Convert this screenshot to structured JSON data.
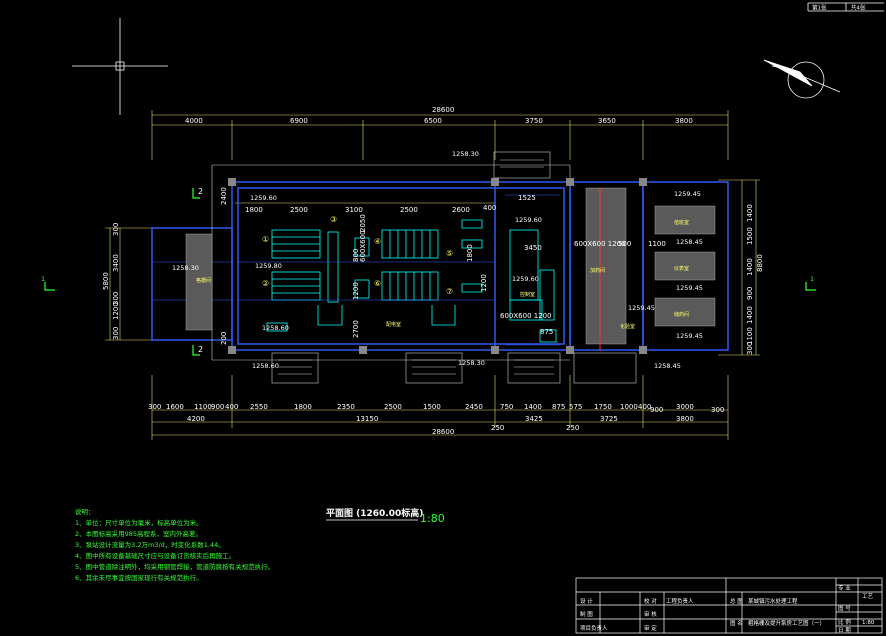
{
  "drawing": {
    "title": "平面图 (1260.00标高)",
    "scale": "1:80"
  },
  "dims_top": {
    "overall": "28600",
    "segments": [
      "4000",
      "6900",
      "6500",
      "3750",
      "3650",
      "3800"
    ]
  },
  "dims_bottom": {
    "overall": "28600",
    "row1": [
      "300",
      "1600",
      "1100",
      "900",
      "400",
      "2550",
      "1800",
      "2350",
      "2500",
      "1500",
      "2450",
      "750",
      "1400",
      "875",
      "575",
      "1750",
      "1000",
      "400",
      "900",
      "3000",
      "300"
    ],
    "row2": [
      "4200",
      "13150",
      "250",
      "3425",
      "3725",
      "3800"
    ],
    "row2_extra": [
      "250"
    ]
  },
  "dims_inner_top": [
    "1800",
    "2500",
    "3100",
    "2500",
    "2600",
    "400",
    "1525"
  ],
  "dims_left": [
    "5800",
    "3400",
    "300",
    "1200",
    "300",
    "300",
    "2400",
    "200"
  ],
  "dims_right": [
    "8800",
    "1100",
    "1400",
    "900",
    "1400",
    "1500",
    "1400",
    "300",
    "3100"
  ],
  "dims_inner_vertical": [
    "600X600",
    "2050",
    "1200",
    "800",
    "2700",
    "1800",
    "1200"
  ],
  "dims_inner_misc": [
    "600X600 1200",
    "3450",
    "600X600 1200",
    "875",
    "500",
    "1100"
  ],
  "elevations": [
    "1258.30",
    "1259.60",
    "1259.45",
    "1258.45",
    "1259.80",
    "1259.60",
    "1258.30",
    "1259.45",
    "1258.60",
    "1259.45",
    "1259.45",
    "1258.30",
    "1258.45",
    "1259.60",
    "1258.60"
  ],
  "section_marks": [
    "1",
    "1",
    "2",
    "2"
  ],
  "circle_labels": [
    "①",
    "②",
    "③",
    "④",
    "⑤",
    "⑥",
    "⑦"
  ],
  "room_labels": [
    "格栅间",
    "配电室",
    "值班室",
    "仪表室",
    "储药间",
    "控制室",
    "加药间",
    "化验室"
  ],
  "notes": {
    "heading": "说明：",
    "items": [
      "1、单位：尺寸单位为毫米，标高单位为米。",
      "2、本图标高采用985高程系，室内外高差。",
      "3、泵站设计流量为3.2万m3/d，时变化系数1.44。",
      "4、图中所有设备基础尺寸应与设备订货核实后再施工。",
      "5、图中管道除注明外，均采用钢管焊接，管道防腐按有关规范执行。",
      "6、其余未尽事宜按国家现行有关规范执行。"
    ]
  },
  "title_block": {
    "project": "某城镇污水处理工程",
    "drawing_name": "粗格栅及提升泵房工艺图（一）",
    "labels": [
      "设 计",
      "制 图",
      "校 对",
      "审 核",
      "审 定",
      "专业负责人",
      "工程负责人",
      "项目负责人",
      "总 图",
      "图 名",
      "图 号",
      "比 例",
      "日 期",
      "专 业"
    ],
    "values": [
      "工艺",
      "1:80"
    ],
    "sheet": [
      "第1张",
      "共4张"
    ]
  },
  "colors": {
    "background": "#000000",
    "wall": "#3060ff",
    "dimension": "#ffff00",
    "text": "#ffffff",
    "equipment": "#00ffff",
    "note": "#33ff33",
    "pipe": "#ff3030"
  }
}
